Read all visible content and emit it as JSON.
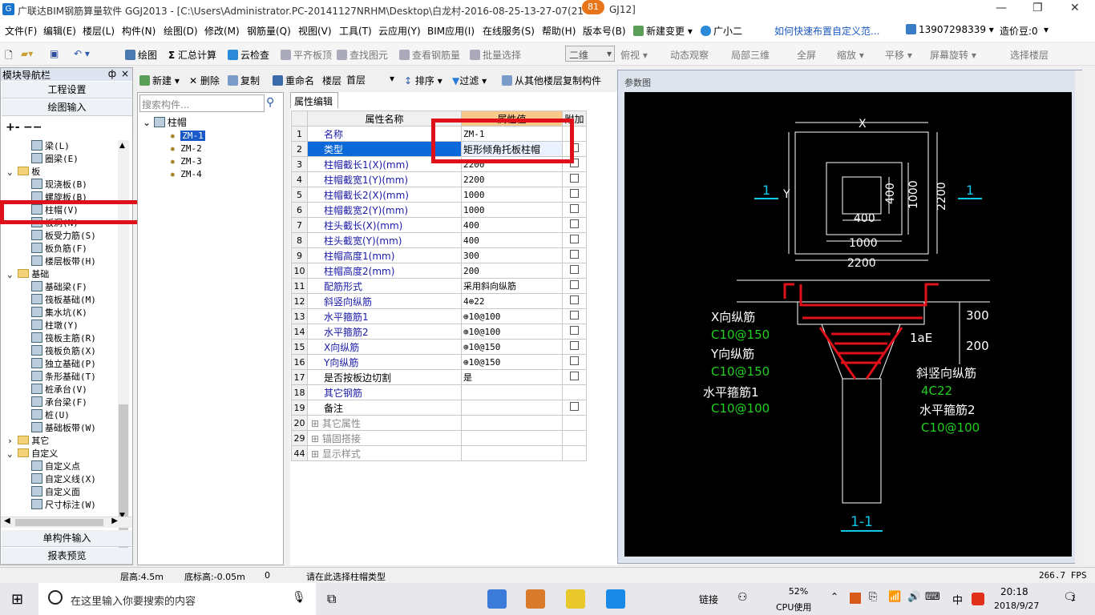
{
  "window": {
    "title": "广联达BIM钢筋算量软件 GGJ2013 - [C:\\Users\\Administrator.PC-20141127NRHM\\Desktop\\白龙村-2016-08-25-13-27-07(21",
    "title_tail": "GJ12]",
    "badge": "81"
  },
  "menu": {
    "items": [
      "文件(F)",
      "编辑(E)",
      "楼层(L)",
      "构件(N)",
      "绘图(D)",
      "修改(M)",
      "钢筋量(Q)",
      "视图(V)",
      "工具(T)",
      "云应用(Y)",
      "BIM应用(I)",
      "在线服务(S)",
      "帮助(H)",
      "版本号(B)"
    ],
    "new_change": "新建变更",
    "assistant": "广小二",
    "link": "如何快速布置自定义范...",
    "phone": "13907298339",
    "beans": "造价豆:0"
  },
  "toolbar": {
    "items": [
      "绘图",
      "汇总计算",
      "云检查",
      "平齐板顶",
      "查找图元",
      "查看钢筋量",
      "批量选择"
    ],
    "view_mode": "二维",
    "items2": [
      "俯视",
      "动态观察",
      "局部三维",
      "全屏",
      "缩放",
      "平移",
      "屏幕旋转",
      "选择楼层"
    ]
  },
  "nav": {
    "title": "模块导航栏",
    "pin": "ф",
    "close": "×",
    "section1": "工程设置",
    "section2": "绘图输入",
    "section3": "单构件输入",
    "section4": "报表预览",
    "tree": [
      {
        "label": "梁(L)",
        "level": 2,
        "type": "item"
      },
      {
        "label": "圈梁(E)",
        "level": 2,
        "type": "item"
      },
      {
        "label": "板",
        "level": 1,
        "type": "folder",
        "toggle": "⌄"
      },
      {
        "label": "现浇板(B)",
        "level": 2,
        "type": "item"
      },
      {
        "label": "螺旋板(B)",
        "level": 2,
        "type": "item"
      },
      {
        "label": "柱帽(V)",
        "level": 2,
        "type": "item"
      },
      {
        "label": "板洞(N)",
        "level": 2,
        "type": "item"
      },
      {
        "label": "板受力筋(S)",
        "level": 2,
        "type": "item"
      },
      {
        "label": "板负筋(F)",
        "level": 2,
        "type": "item"
      },
      {
        "label": "楼层板带(H)",
        "level": 2,
        "type": "item"
      },
      {
        "label": "基础",
        "level": 1,
        "type": "folder",
        "toggle": "⌄"
      },
      {
        "label": "基础梁(F)",
        "level": 2,
        "type": "item"
      },
      {
        "label": "筏板基础(M)",
        "level": 2,
        "type": "item"
      },
      {
        "label": "集水坑(K)",
        "level": 2,
        "type": "item"
      },
      {
        "label": "柱墩(Y)",
        "level": 2,
        "type": "item"
      },
      {
        "label": "筏板主筋(R)",
        "level": 2,
        "type": "item"
      },
      {
        "label": "筏板负筋(X)",
        "level": 2,
        "type": "item"
      },
      {
        "label": "独立基础(P)",
        "level": 2,
        "type": "item"
      },
      {
        "label": "条形基础(T)",
        "level": 2,
        "type": "item"
      },
      {
        "label": "桩承台(V)",
        "level": 2,
        "type": "item"
      },
      {
        "label": "承台梁(F)",
        "level": 2,
        "type": "item"
      },
      {
        "label": "桩(U)",
        "level": 2,
        "type": "item"
      },
      {
        "label": "基础板带(W)",
        "level": 2,
        "type": "item"
      },
      {
        "label": "其它",
        "level": 1,
        "type": "folder",
        "toggle": "›"
      },
      {
        "label": "自定义",
        "level": 1,
        "type": "folder",
        "toggle": "⌄"
      },
      {
        "label": "自定义点",
        "level": 2,
        "type": "item"
      },
      {
        "label": "自定义线(X)",
        "level": 2,
        "type": "item"
      },
      {
        "label": "自定义面",
        "level": 2,
        "type": "item"
      },
      {
        "label": "尺寸标注(W)",
        "level": 2,
        "type": "item"
      }
    ]
  },
  "comp_toolbar": {
    "new": "新建",
    "delete": "删除",
    "copy": "复制",
    "rename": "重命名",
    "floor_label": "楼层",
    "floor_value": "首层",
    "sort": "排序",
    "filter": "过滤",
    "copy_from": "从其他楼层复制构件"
  },
  "search": {
    "placeholder": "搜索构件..."
  },
  "comp_tree": {
    "root": "柱帽",
    "items": [
      "ZM-1",
      "ZM-2",
      "ZM-3",
      "ZM-4"
    ],
    "selected": 0
  },
  "prop": {
    "tab": "属性编辑",
    "col_name": "属性名称",
    "col_value": "属性值",
    "col_add": "附加",
    "rows": [
      {
        "n": "1",
        "name": "名称",
        "value": "ZM-1",
        "check": false,
        "cb": false
      },
      {
        "n": "2",
        "name": "类型",
        "value": "矩形倾角托板柱帽",
        "check": true,
        "cb": true,
        "selected": true
      },
      {
        "n": "3",
        "name": "柱帽截长1(X)(mm)",
        "value": "2200",
        "cb": true
      },
      {
        "n": "4",
        "name": "柱帽截宽1(Y)(mm)",
        "value": "2200",
        "cb": true
      },
      {
        "n": "5",
        "name": "柱帽截长2(X)(mm)",
        "value": "1000",
        "cb": true
      },
      {
        "n": "6",
        "name": "柱帽截宽2(Y)(mm)",
        "value": "1000",
        "cb": true
      },
      {
        "n": "7",
        "name": "柱头截长(X)(mm)",
        "value": "400",
        "cb": true
      },
      {
        "n": "8",
        "name": "柱头截宽(Y)(mm)",
        "value": "400",
        "cb": true
      },
      {
        "n": "9",
        "name": "柱帽高度1(mm)",
        "value": "300",
        "cb": true
      },
      {
        "n": "10",
        "name": "柱帽高度2(mm)",
        "value": "200",
        "cb": true
      },
      {
        "n": "11",
        "name": "配筋形式",
        "value": "采用斜向纵筋",
        "cb": true
      },
      {
        "n": "12",
        "name": "斜竖向纵筋",
        "value": "4⊕22",
        "cb": true
      },
      {
        "n": "13",
        "name": "水平箍筋1",
        "value": "⊕10@100",
        "cb": true
      },
      {
        "n": "14",
        "name": "水平箍筋2",
        "value": "⊕10@100",
        "cb": true
      },
      {
        "n": "15",
        "name": "X向纵筋",
        "value": "⊕10@150",
        "cb": true
      },
      {
        "n": "16",
        "name": "Y向纵筋",
        "value": "⊕10@150",
        "cb": true
      },
      {
        "n": "17",
        "name": "是否按板边切割",
        "value": "是",
        "cb": true,
        "black": true
      },
      {
        "n": "18",
        "name": "其它钢筋",
        "value": "",
        "cb": false
      },
      {
        "n": "19",
        "name": "备注",
        "value": "",
        "cb": true,
        "black": true
      },
      {
        "n": "20",
        "name": "其它属性",
        "value": "",
        "cb": false,
        "group": true
      },
      {
        "n": "29",
        "name": "锚固搭接",
        "value": "",
        "cb": false,
        "group": true
      },
      {
        "n": "44",
        "name": "显示样式",
        "value": "",
        "cb": false,
        "group": true
      }
    ]
  },
  "dialog": {
    "title": "参数图",
    "plan": {
      "x": "X",
      "y": "Y",
      "d1": "400",
      "d2": "400",
      "d3": "1000",
      "d4": "1000",
      "d5": "2200",
      "d6": "2200",
      "sec": "1"
    },
    "section": {
      "x_bar": "X向纵筋",
      "x_bar_v": "C10@150",
      "y_bar": "Y向纵筋",
      "y_bar_v": "C10@150",
      "hoop1": "水平箍筋1",
      "hoop1_v": "C10@100",
      "hoop2": "水平箍筋2",
      "hoop2_v": "C10@100",
      "slant": "斜竖向纵筋",
      "slant_v": "4C22",
      "lae": "1aE",
      "h1": "300",
      "h2": "200",
      "label": "1-1"
    }
  },
  "status": {
    "floor_h": "层高:4.5m",
    "base_h": "底标高:-0.05m",
    "zero": "0",
    "hint": "请在此选择柱帽类型",
    "fps": "266.7 FPS"
  },
  "taskbar": {
    "search": "在这里输入你要搜索的内容",
    "link": "链接",
    "cpu": "52%",
    "cpu_label": "CPU使用",
    "ime": "中",
    "time": "20:18",
    "date": "2018/9/27",
    "notify": "1"
  },
  "colors": {
    "highlight": "#e0101a",
    "accent": "#0a68d8",
    "green": "#20d020",
    "cyan": "#10c8e8"
  }
}
